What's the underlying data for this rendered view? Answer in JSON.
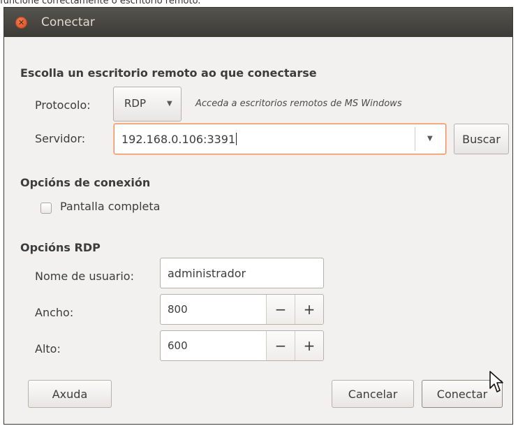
{
  "top_text": "funcione correctamente o escritorio remoto.",
  "window": {
    "title": "Conectar",
    "close_icon": "close-icon"
  },
  "section_remote": {
    "heading": "Escolla un escritorio remoto ao que conectarse",
    "protocol_label": "Protocolo:",
    "protocol_value": "RDP",
    "protocol_hint": "Acceda a escritorios remotos de MS Windows",
    "server_label": "Servidor:",
    "server_value": "192.168.0.106:3391",
    "search_button": "Buscar"
  },
  "section_connection": {
    "heading": "Opcións de conexión",
    "fullscreen_label": "Pantalla completa",
    "fullscreen_checked": false
  },
  "section_rdp": {
    "heading": "Opcións RDP",
    "username_label": "Nome de usuario:",
    "username_value": "administrador",
    "width_label": "Ancho:",
    "width_value": "800",
    "height_label": "Alto:",
    "height_value": "600",
    "minus": "−",
    "plus": "+"
  },
  "buttons": {
    "help": "Axuda",
    "cancel": "Cancelar",
    "connect": "Conectar"
  },
  "icons": {
    "dropdown": "chevron-down-icon",
    "cursor": "mouse-pointer-icon"
  }
}
